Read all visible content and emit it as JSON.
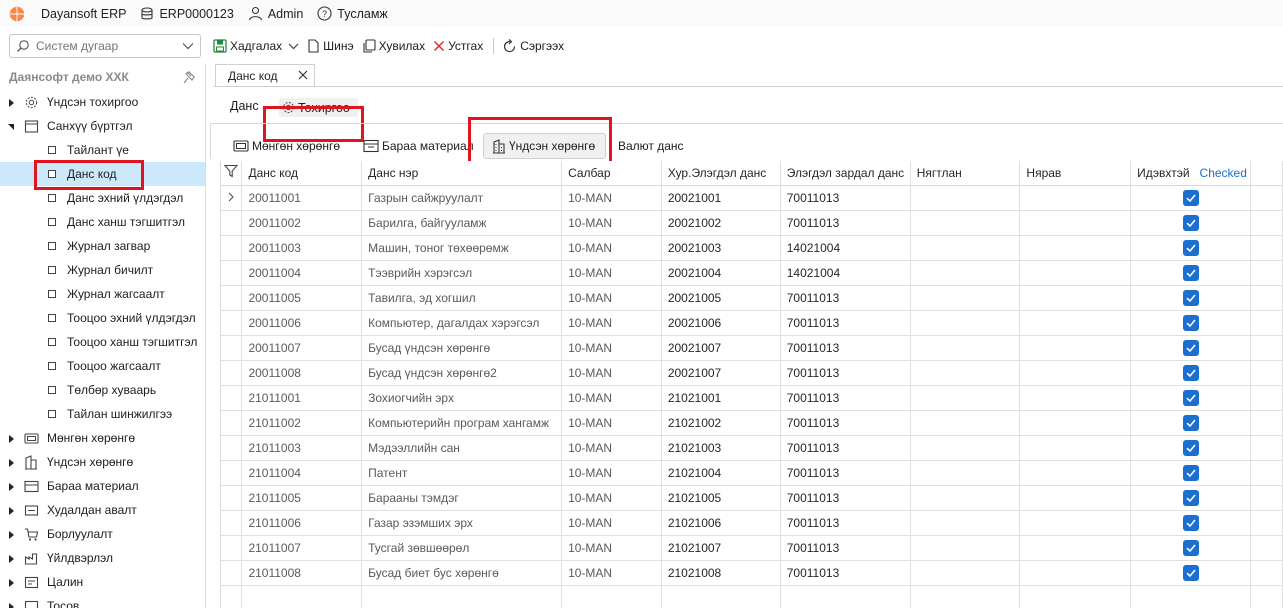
{
  "titlebar": {
    "app_name": "Dayansoft ERP",
    "database": "ERP0000123",
    "user": "Admin",
    "help": "Тусламж"
  },
  "toolbar": {
    "search_placeholder": "Систем дугаар",
    "save": "Хадгалах",
    "new": "Шинэ",
    "copy": "Хувилах",
    "delete": "Устгах",
    "refresh": "Сэргээх"
  },
  "sidebar": {
    "company": "Даянсофт демо ХХК",
    "items": [
      {
        "label": "Үндсэн тохиргоо",
        "icon": "gear-icon",
        "expanded": false
      },
      {
        "label": "Санхүү бүртгэл",
        "icon": "ledger-icon",
        "expanded": true
      },
      {
        "label": "Тайлант үе",
        "child": true
      },
      {
        "label": "Данс код",
        "child": true,
        "selected": true
      },
      {
        "label": "Данс эхний үлдэгдэл",
        "child": true
      },
      {
        "label": "Данс ханш тэгшитгэл",
        "child": true
      },
      {
        "label": "Журнал загвар",
        "child": true
      },
      {
        "label": "Журнал бичилт",
        "child": true
      },
      {
        "label": "Журнал жагсаалт",
        "child": true
      },
      {
        "label": "Тооцоо эхний үлдэгдэл",
        "child": true
      },
      {
        "label": "Тооцоо ханш тэгшитгэл",
        "child": true
      },
      {
        "label": "Тооцоо жагсаалт",
        "child": true
      },
      {
        "label": "Төлбөр хуваарь",
        "child": true
      },
      {
        "label": "Тайлан шинжилгээ",
        "child": true
      },
      {
        "label": "Мөнгөн хөрөнгө",
        "icon": "cash-icon",
        "expanded": false
      },
      {
        "label": "Үндсэн хөрөнгө",
        "icon": "building-icon",
        "expanded": false
      },
      {
        "label": "Бараа материал",
        "icon": "box-icon",
        "expanded": false
      },
      {
        "label": "Худалдан авалт",
        "icon": "purchase-icon",
        "expanded": false
      },
      {
        "label": "Борлуулалт",
        "icon": "cart-icon",
        "expanded": false
      },
      {
        "label": "Үйлдвэрлэл",
        "icon": "factory-icon",
        "expanded": false
      },
      {
        "label": "Цалин",
        "icon": "salary-icon",
        "expanded": false
      },
      {
        "label": "Тосов",
        "icon": "budget-icon",
        "expanded": false
      }
    ]
  },
  "doc_tab": {
    "label": "Данс код"
  },
  "subtabs": {
    "account": "Данс",
    "settings": "Тохиргоо"
  },
  "inner_tabs": {
    "cash": "Мөнгөн хөрөнгө",
    "inventory": "Бараа материал",
    "fixed_assets": "Үндсэн хөрөнгө",
    "currency": "Валют данс"
  },
  "grid": {
    "columns": [
      "Данс код",
      "Данс нэр",
      "Салбар",
      "Хур.Элэгдэл данс",
      "Элэгдэл зардал данс",
      "Нягтлан",
      "Нярав",
      "Идэвхтэй"
    ],
    "checked_label": "Checked",
    "rows": [
      {
        "code": "20011001",
        "name": "Газрын сайжруулалт",
        "branch": "10-MAN",
        "accum": "20021001",
        "expense": "70011013",
        "active": true
      },
      {
        "code": "20011002",
        "name": "Барилга, байгууламж",
        "branch": "10-MAN",
        "accum": "20021002",
        "expense": "70011013",
        "active": true
      },
      {
        "code": "20011003",
        "name": "Машин, тоног төхөөрөмж",
        "branch": "10-MAN",
        "accum": "20021003",
        "expense": "14021004",
        "active": true
      },
      {
        "code": "20011004",
        "name": "Тээврийн хэрэгсэл",
        "branch": "10-MAN",
        "accum": "20021004",
        "expense": "14021004",
        "active": true
      },
      {
        "code": "20011005",
        "name": "Тавилга, эд хогшил",
        "branch": "10-MAN",
        "accum": "20021005",
        "expense": "70011013",
        "active": true
      },
      {
        "code": "20011006",
        "name": "Компьютер, дагалдах хэрэгсэл",
        "branch": "10-MAN",
        "accum": "20021006",
        "expense": "70011013",
        "active": true
      },
      {
        "code": "20011007",
        "name": "Бусад үндсэн хөрөнгө",
        "branch": "10-MAN",
        "accum": "20021007",
        "expense": "70011013",
        "active": true
      },
      {
        "code": "20011008",
        "name": "Бусад үндсэн хөрөнгө2",
        "branch": "10-MAN",
        "accum": "20021007",
        "expense": "70011013",
        "active": true
      },
      {
        "code": "21011001",
        "name": "Зохиогчийн эрх",
        "branch": "10-MAN",
        "accum": "21021001",
        "expense": "70011013",
        "active": true
      },
      {
        "code": "21011002",
        "name": "Компьютерийн програм хангамж",
        "branch": "10-MAN",
        "accum": "21021002",
        "expense": "70011013",
        "active": true
      },
      {
        "code": "21011003",
        "name": "Мэдээллийн сан",
        "branch": "10-MAN",
        "accum": "21021003",
        "expense": "70011013",
        "active": true
      },
      {
        "code": "21011004",
        "name": "Патент",
        "branch": "10-MAN",
        "accum": "21021004",
        "expense": "70011013",
        "active": true
      },
      {
        "code": "21011005",
        "name": "Барааны тэмдэг",
        "branch": "10-MAN",
        "accum": "21021005",
        "expense": "70011013",
        "active": true
      },
      {
        "code": "21011006",
        "name": "Газар эзэмших эрх",
        "branch": "10-MAN",
        "accum": "21021006",
        "expense": "70011013",
        "active": true
      },
      {
        "code": "21011007",
        "name": "Тусгай зөвшөөрөл",
        "branch": "10-MAN",
        "accum": "21021007",
        "expense": "70011013",
        "active": true
      },
      {
        "code": "21011008",
        "name": "Бусад биет бус хөрөнгө",
        "branch": "10-MAN",
        "accum": "21021008",
        "expense": "70011013",
        "active": true
      }
    ]
  },
  "colors": {
    "highlight_red": "#e0141e",
    "selection": "#cce8fb",
    "check_blue": "#1a6fd1"
  }
}
